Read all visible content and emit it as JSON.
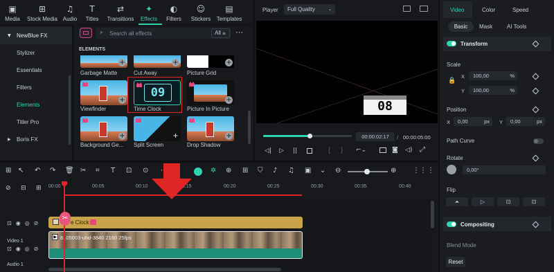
{
  "toolbar": {
    "items": [
      {
        "label": "Media",
        "icon": "media-icon"
      },
      {
        "label": "Stock Media",
        "icon": "stock-media-icon"
      },
      {
        "label": "Audio",
        "icon": "audio-icon"
      },
      {
        "label": "Titles",
        "icon": "titles-icon"
      },
      {
        "label": "Transitions",
        "icon": "transitions-icon"
      },
      {
        "label": "Effects",
        "icon": "effects-icon"
      },
      {
        "label": "Filters",
        "icon": "filters-icon"
      },
      {
        "label": "Stickers",
        "icon": "stickers-icon"
      },
      {
        "label": "Templates",
        "icon": "templates-icon"
      }
    ],
    "active": "Effects"
  },
  "sidebar": {
    "items": [
      {
        "label": "NewBlue FX"
      },
      {
        "label": "Stylizer"
      },
      {
        "label": "Essentials"
      },
      {
        "label": "Filters"
      },
      {
        "label": "Elements"
      },
      {
        "label": "Titler Pro"
      },
      {
        "label": "Boris FX"
      }
    ]
  },
  "library": {
    "search_placeholder": "Search all effects",
    "filter_label": "All",
    "section_title": "ELEMENTS",
    "items": [
      {
        "label": "Garbage Matte"
      },
      {
        "label": "Cut Away"
      },
      {
        "label": "Picture Grid"
      },
      {
        "label": "Viewfinder"
      },
      {
        "label": "Time Clock"
      },
      {
        "label": "Picture In Picture"
      },
      {
        "label": "Background Ge..."
      },
      {
        "label": "Split Screen"
      },
      {
        "label": "Drop Shadow"
      }
    ],
    "clock_digits": "09"
  },
  "player": {
    "label": "Player",
    "quality": "Full Quality",
    "preview_digits": "08",
    "current_time": "00:00:02:17",
    "separator": "/",
    "total_time": "00:00:05:00",
    "progress_percent": 52
  },
  "properties": {
    "tabs": [
      "Video",
      "Color",
      "Speed"
    ],
    "subtabs": [
      "Basic",
      "Mask",
      "AI Tools"
    ],
    "transform_label": "Transform",
    "scale_label": "Scale",
    "scale_x_axis": "X",
    "scale_x": "100,00",
    "scale_y_axis": "Y",
    "scale_y": "100,00",
    "percent_unit": "%",
    "position_label": "Position",
    "pos_x_axis": "X",
    "pos_x": "0,00",
    "pos_y_axis": "Y",
    "pos_y": "0,00",
    "px_unit": "px",
    "path_curve_label": "Path Curve",
    "rotate_label": "Rotate",
    "rotate_value": "0,00°",
    "flip_label": "Flip",
    "compositing_label": "Compositing",
    "blend_mode_label": "Blend Mode",
    "reset_label": "Reset"
  },
  "timeline": {
    "ruler": [
      "00:00",
      "00:05",
      "00:10",
      "00:15",
      "00:20",
      "00:25",
      "00:30",
      "00:35",
      "00:40"
    ],
    "effect_clip_label": "e Clock",
    "video_clip_label": "8105003-uhd-3840 2160 25fps",
    "track_video_label": "Video 1",
    "track_audio_label": "Audio 1",
    "accent": "#2fd3b0",
    "arrow_color": "#e02525"
  }
}
